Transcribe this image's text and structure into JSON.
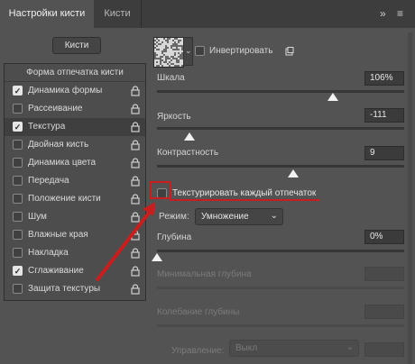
{
  "tabs": [
    {
      "label": "Настройки кисти"
    },
    {
      "label": "Кисти"
    }
  ],
  "left": {
    "brushes_button": "Кисти",
    "header": "Форма отпечатка кисти",
    "items": [
      {
        "label": "Динамика формы",
        "checked": true,
        "lock": true
      },
      {
        "label": "Рассеивание",
        "checked": false,
        "lock": true
      },
      {
        "label": "Текстура",
        "checked": true,
        "lock": true,
        "selected": true
      },
      {
        "label": "Двойная кисть",
        "checked": false,
        "lock": true
      },
      {
        "label": "Динамика цвета",
        "checked": false,
        "lock": true
      },
      {
        "label": "Передача",
        "checked": false,
        "lock": true
      },
      {
        "label": "Положение кисти",
        "checked": false,
        "lock": true
      },
      {
        "label": "Шум",
        "checked": false,
        "lock": true
      },
      {
        "label": "Влажные края",
        "checked": false,
        "lock": true
      },
      {
        "label": "Накладка",
        "checked": false,
        "lock": true
      },
      {
        "label": "Сглаживание",
        "checked": true,
        "lock": true
      },
      {
        "label": "Защита текстуры",
        "checked": false,
        "lock": true
      }
    ]
  },
  "texture": {
    "invert_label": "Инвертировать",
    "invert_checked": false,
    "scale": {
      "label": "Шкала",
      "value": "106%",
      "level": 0.71
    },
    "brightness": {
      "label": "Яркость",
      "value": "-111",
      "level": 0.13
    },
    "contrast": {
      "label": "Контрастность",
      "value": "9",
      "level": 0.55
    },
    "texture_each_tip": {
      "label": "Текстурировать каждый отпечаток",
      "checked": false
    },
    "mode": {
      "label": "Режим:",
      "value": "Умножение"
    },
    "depth": {
      "label": "Глубина",
      "value": "0%",
      "level": 0.0
    },
    "min_depth": {
      "label": "Минимальная глубина",
      "value": ""
    },
    "depth_jitter": {
      "label": "Колебание глубины",
      "value": ""
    },
    "control": {
      "label": "Управление:",
      "value": "Выкл"
    }
  },
  "colors": {
    "annotation_red": "#c81e1e",
    "panel": "#535353"
  }
}
